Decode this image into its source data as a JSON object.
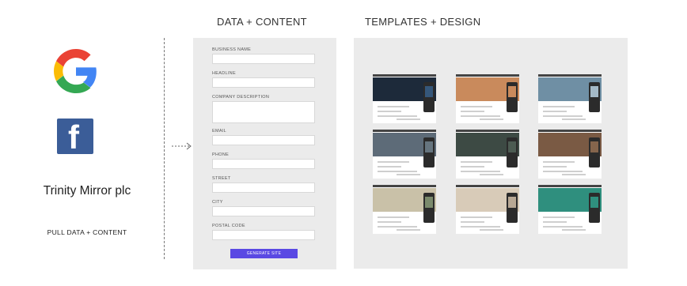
{
  "left": {
    "google_icon": "google-logo",
    "facebook_icon": "facebook-logo",
    "brand": "Trinity Mirror plc",
    "pull_label": "PULL DATA + CONTENT"
  },
  "sections": {
    "data_title": "DATA + CONTENT",
    "templates_title": "TEMPLATES + DESIGN"
  },
  "form": {
    "business_name": "BUSINESS NAME",
    "headline": "HEADLINE",
    "company_description": "COMPANY DESCRIPTION",
    "email": "EMAIL",
    "phone": "PHONE",
    "street": "STREET",
    "city": "CITY",
    "postal_code": "POSTAL CODE",
    "generate_button": "GENERATE SITE"
  },
  "colors": {
    "facebook": "#3b5d98",
    "generate_button": "#5a49e3",
    "panel_bg": "#ebebeb"
  },
  "templates": [
    {
      "hero": "#1d2a3a",
      "phone": "#35577a"
    },
    {
      "hero": "#c98a5c",
      "phone": "#c98a5c"
    },
    {
      "hero": "#6f8fa4",
      "phone": "#a4b9c6"
    },
    {
      "hero": "#5d6b78",
      "phone": "#66757f"
    },
    {
      "hero": "#3d4a44",
      "phone": "#4c5b52"
    },
    {
      "hero": "#7a5a44",
      "phone": "#85654c"
    },
    {
      "hero": "#c9c1a8",
      "phone": "#7a8a6c"
    },
    {
      "hero": "#d8cbb8",
      "phone": "#b8a894"
    },
    {
      "hero": "#2f8f7e",
      "phone": "#2f8f7e"
    }
  ]
}
